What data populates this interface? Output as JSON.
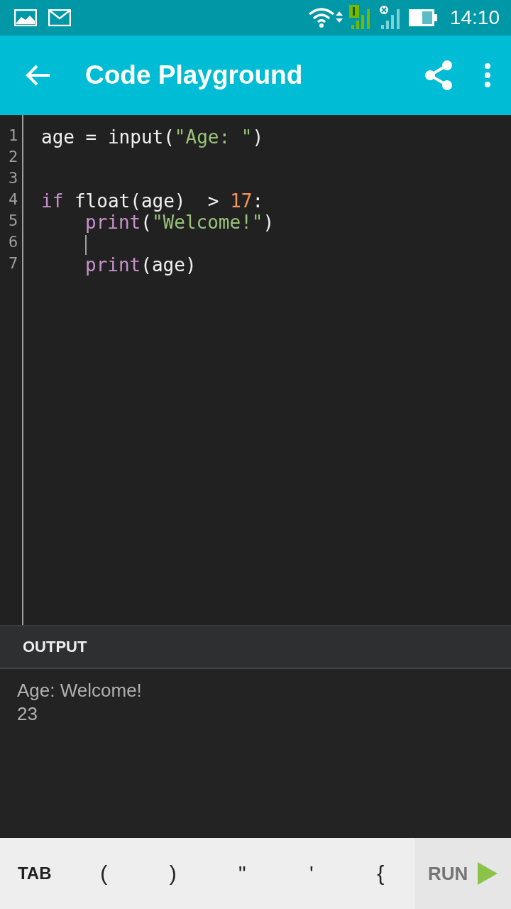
{
  "status_bar": {
    "time": "14:10"
  },
  "app_bar": {
    "title": "Code Playground"
  },
  "editor": {
    "lines": [
      {
        "number": "1",
        "cursor": false,
        "tokens": [
          {
            "kind": "plain",
            "text": "age = input("
          },
          {
            "kind": "string",
            "text": "\"Age: \""
          },
          {
            "kind": "plain",
            "text": ")"
          }
        ]
      },
      {
        "number": "2",
        "cursor": false
      },
      {
        "number": "3",
        "cursor": false
      },
      {
        "number": "4",
        "cursor": false,
        "tokens": [
          {
            "kind": "keyword",
            "text": "if"
          },
          {
            "kind": "plain",
            "text": " float(age)  > "
          },
          {
            "kind": "number",
            "text": "17"
          },
          {
            "kind": "plain",
            "text": ":"
          }
        ]
      },
      {
        "number": "5",
        "cursor": false,
        "indented": true,
        "tokens": [
          {
            "kind": "keyword",
            "text": "print"
          },
          {
            "kind": "plain",
            "text": "("
          },
          {
            "kind": "string",
            "text": "\"Welcome!\""
          },
          {
            "kind": "plain",
            "text": ")"
          }
        ]
      },
      {
        "number": "6",
        "cursor": true,
        "indented": true
      },
      {
        "number": "7",
        "cursor": false,
        "indented": true,
        "tokens": [
          {
            "kind": "keyword",
            "text": "print"
          },
          {
            "kind": "plain",
            "text": "(age)"
          }
        ]
      }
    ]
  },
  "output": {
    "title": "OUTPUT",
    "lines": [
      "Age: Welcome!",
      "23"
    ]
  },
  "key_bar": {
    "keys": [
      "TAB",
      "(",
      ")",
      "\"",
      "'",
      "{"
    ],
    "run_label": "RUN"
  }
}
